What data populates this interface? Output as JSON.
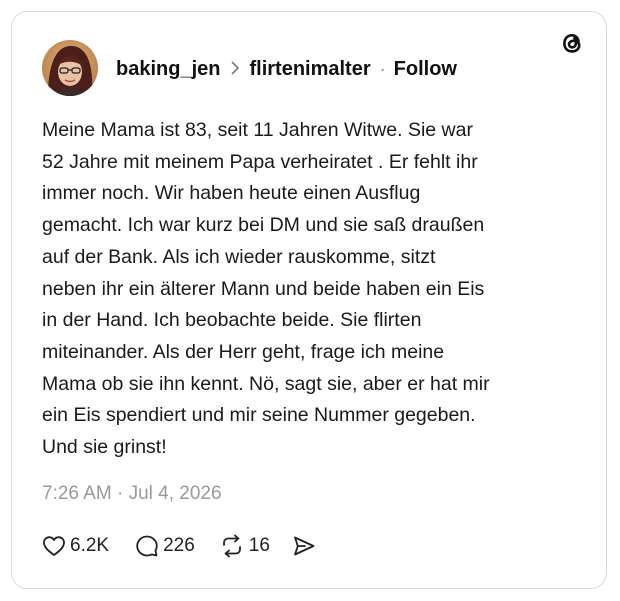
{
  "post": {
    "author": "baking_jen",
    "reply_to": "flirtenimalter",
    "separator": "·",
    "follow_label": "Follow",
    "text_lines": [
      "Meine Mama ist 83, seit 11 Jahren Witwe. Sie war",
      "52 Jahre mit meinem Papa verheiratet . Er fehlt ihr",
      "immer noch. Wir haben heute einen Ausflug",
      "gemacht. Ich war kurz bei DM und sie saß draußen",
      "auf der Bank. Als ich wieder rauskomme, sitzt",
      "neben ihr ein älterer Mann und beide haben ein Eis",
      "in der Hand. Ich beobachte beide. Sie flirten",
      "miteinander. Als der Herr geht, frage ich meine",
      "Mama ob sie ihn kennt. Nö, sagt sie, aber er hat mir",
      "ein Eis spendiert und mir seine Nummer gegeben.",
      "Und sie grinst!"
    ],
    "timestamp": "7:26 AM · Jul 4, 2026"
  },
  "actions": {
    "likes": "6.2K",
    "replies": "226",
    "reposts": "16"
  },
  "icons": {
    "brand": "threads-logo-icon",
    "like": "heart-icon",
    "reply": "speech-bubble-icon",
    "repost": "repost-icon",
    "share": "send-icon"
  },
  "colors": {
    "text": "#111111",
    "muted": "#999999",
    "border": "#d9d9d9"
  }
}
